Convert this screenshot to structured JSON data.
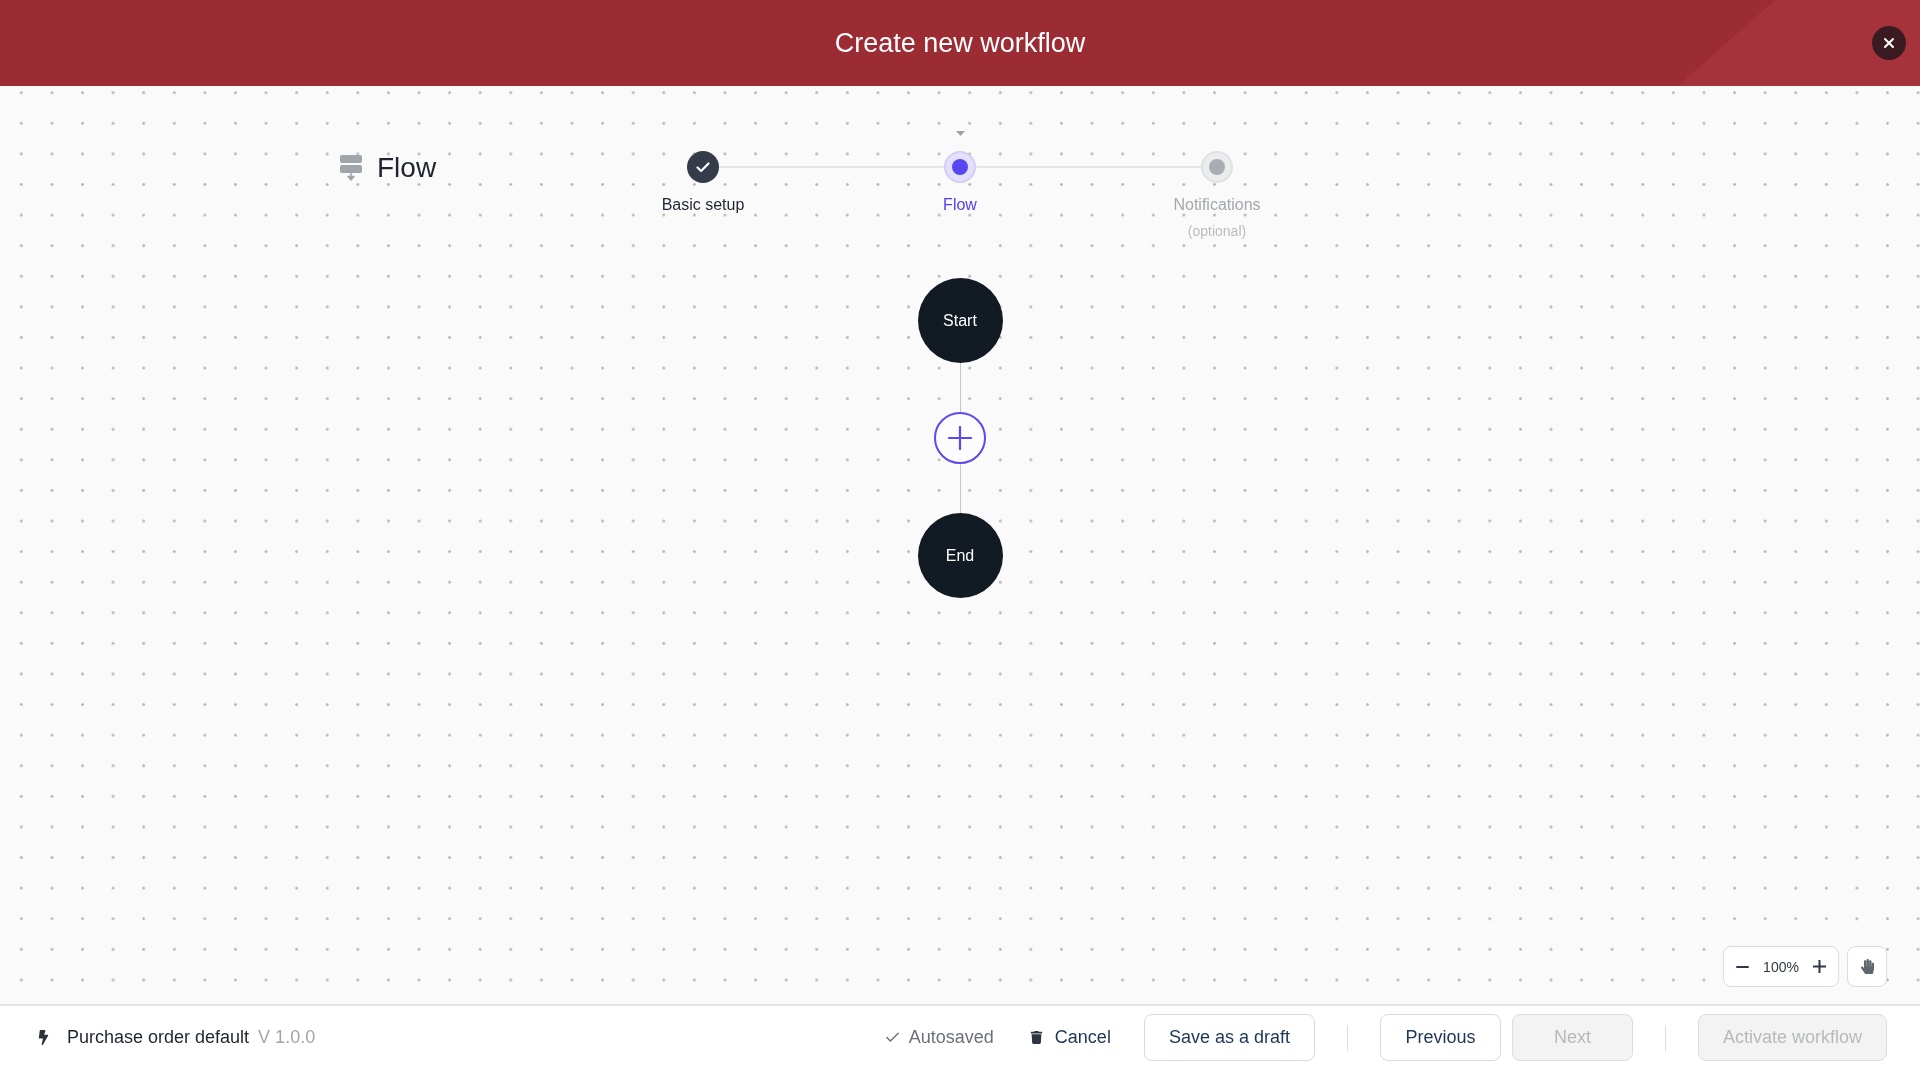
{
  "header": {
    "title": "Create new workflow"
  },
  "page_title": "Flow",
  "stepper": [
    {
      "label": "Basic setup",
      "completed": true,
      "selected": false
    },
    {
      "label": "Flow",
      "completed": false,
      "selected": true
    },
    {
      "label": "Notifications",
      "sublabel": "(optional)",
      "completed": false,
      "selected": false
    }
  ],
  "flow_nodes": [
    {
      "kind": "terminal",
      "label": "Start"
    },
    {
      "kind": "add"
    },
    {
      "kind": "terminal",
      "label": "End"
    }
  ],
  "zoom_controls": {
    "reading": "100%"
  },
  "footer": {
    "workflow_name": "Purchase order default",
    "version": "V 1.0.0",
    "save_status": "Autosaved",
    "cancel": "Cancel",
    "button_groups": [
      {
        "buttons": [
          {
            "label": "Save as a draft",
            "disabled": false
          }
        ]
      },
      {
        "buttons": [
          {
            "label": "Previous",
            "disabled": false
          },
          {
            "label": "Next",
            "disabled": true
          }
        ]
      },
      {
        "buttons": [
          {
            "label": "Activate workflow",
            "disabled": true
          }
        ]
      }
    ]
  }
}
